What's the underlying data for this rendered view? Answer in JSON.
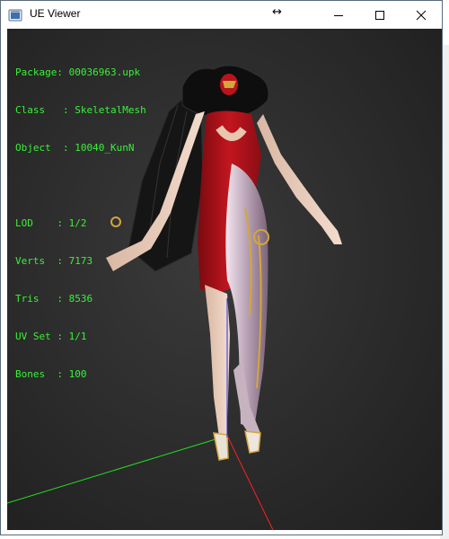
{
  "window": {
    "title": "UE Viewer",
    "icon": "app-icon",
    "controls": {
      "minimize": "minimize-icon",
      "maximize": "maximize-icon",
      "close": "close-icon"
    }
  },
  "info": {
    "package_label": "Package",
    "package_value": "00036963.upk",
    "class_label": "Class",
    "class_value": "SkeletalMesh",
    "object_label": "Object",
    "object_value": "10040_KunN",
    "lod_label": "LOD",
    "lod_value": "1/2",
    "verts_label": "Verts",
    "verts_value": "7173",
    "tris_label": "Tris",
    "tris_value": "8536",
    "uvset_label": "UV Set",
    "uvset_value": "1/1",
    "bones_label": "Bones",
    "bones_value": "100"
  },
  "colors": {
    "overlay_text": "#37f237",
    "viewport_bg": "#2a2a2a",
    "axis_x": "#ff2020",
    "axis_y": "#20e020",
    "axis_z": "#2030ff"
  }
}
